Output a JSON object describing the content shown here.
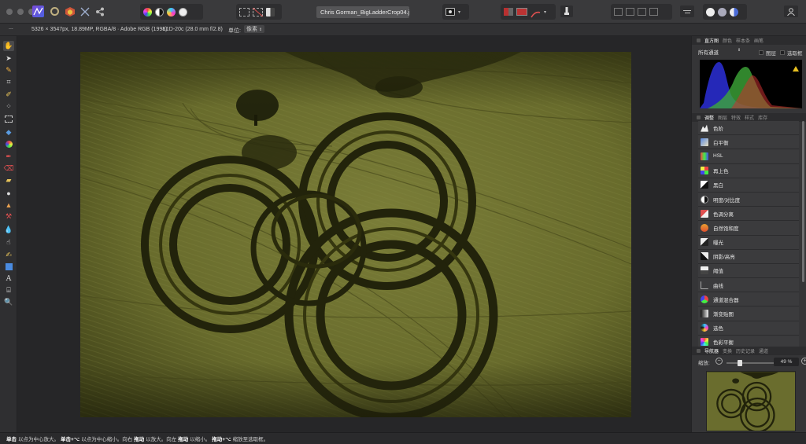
{
  "window": {
    "document_title": "Chris Gorman_BigLadderCrop04.jpg (49..."
  },
  "context_bar": {
    "doc_info": "5326 × 3547px, 18.89MP, RGBA/8 · Adobe RGB (1998)",
    "camera_info": "L1D-20c (28.0 mm f/2.8)",
    "unit_label": "单位:",
    "unit_value": "像素",
    "more": "..."
  },
  "right_panel": {
    "top_tabs": [
      "直方图",
      "颜色",
      "样本条",
      "画笔"
    ],
    "histogram": {
      "channel_select": "所有通道",
      "option_layer": "图层",
      "option_selection": "选取框",
      "warning_icon": "warning-triangle-icon"
    },
    "mid_tabs": [
      "调整",
      "图层",
      "特效",
      "样式",
      "库存"
    ],
    "adjustments": [
      {
        "label": "色阶",
        "icon": "levels-icon"
      },
      {
        "label": "白平衡",
        "icon": "white-balance-icon"
      },
      {
        "label": "HSL",
        "icon": "hsl-icon"
      },
      {
        "label": "再上色",
        "icon": "recolor-icon"
      },
      {
        "label": "黑白",
        "icon": "black-white-icon"
      },
      {
        "label": "明度/对比度",
        "icon": "brightness-contrast-icon"
      },
      {
        "label": "色调分离",
        "icon": "posterize-icon"
      },
      {
        "label": "自然饱和度",
        "icon": "vibrance-icon"
      },
      {
        "label": "曝光",
        "icon": "exposure-icon"
      },
      {
        "label": "阴影/高亮",
        "icon": "shadows-highlights-icon"
      },
      {
        "label": "阈值",
        "icon": "threshold-icon"
      },
      {
        "label": "曲线",
        "icon": "curves-icon"
      },
      {
        "label": "通道混合器",
        "icon": "channel-mixer-icon"
      },
      {
        "label": "渐变贴图",
        "icon": "gradient-map-icon"
      },
      {
        "label": "选色",
        "icon": "selective-color-icon"
      },
      {
        "label": "色彩平衡",
        "icon": "color-balance-icon"
      }
    ],
    "bottom_tabs": [
      "导航器",
      "变换",
      "历史记录",
      "通道"
    ],
    "navigator": {
      "zoom_label": "缩放:",
      "zoom_value": "49 %"
    }
  },
  "status_bar": {
    "p1_bold": "单击",
    "p1": "以点为中心放大。",
    "p2_bold": "单击+⌥",
    "p2": "以点为中心缩小。向右",
    "p3_bold": "拖动",
    "p3": "以放大。向左",
    "p4_bold": "拖动",
    "p4": "以缩小。",
    "p5_bold": "拖动+⌥",
    "p5": "缩放至选取框。"
  },
  "colors": {
    "panel_bg": "#353537",
    "toolbar_bg": "#3a3a3c",
    "canvas_bg": "#262628",
    "field_green": "#6f7232",
    "field_dark": "#3c3e16"
  }
}
